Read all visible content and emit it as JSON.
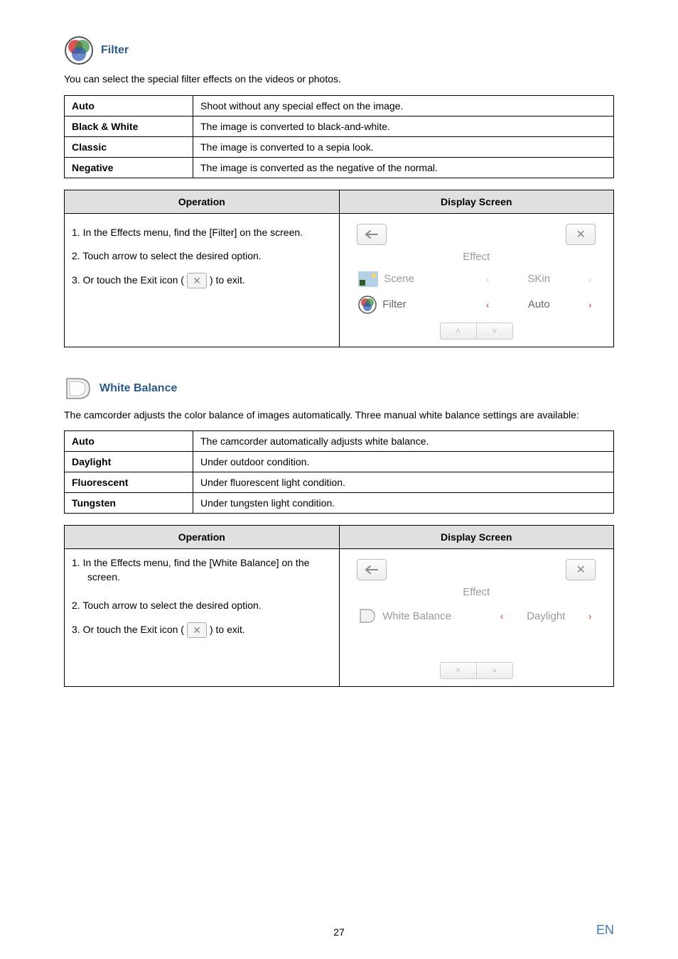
{
  "filter": {
    "title": "Filter",
    "intro": "You can select the special filter effects on the videos or photos.",
    "options": [
      {
        "name": "Auto",
        "desc": "Shoot without any special effect on the image."
      },
      {
        "name": "Black & White",
        "desc": "The image is converted to black-and-white."
      },
      {
        "name": "Classic",
        "desc": "The image is converted to a sepia look."
      },
      {
        "name": "Negative",
        "desc": "The image is converted as the negative of the normal."
      }
    ],
    "table": {
      "header_op": "Operation",
      "header_disp": "Display Screen",
      "steps": {
        "s1": "1.  In the Effects menu, find the [Filter] on the screen.",
        "s2": "2.  Touch arrow to select the desired option.",
        "s3a": "3.  Or touch the Exit icon (",
        "s3b": ") to exit."
      },
      "screen": {
        "title": "Effect",
        "row1_label": "Scene",
        "row1_value": "SKin",
        "row2_label": "Filter",
        "row2_value": "Auto"
      }
    }
  },
  "wb": {
    "title": "White Balance",
    "intro": "The camcorder adjusts the color balance of images automatically. Three manual white balance settings are available:",
    "options": [
      {
        "name": "Auto",
        "desc": "The camcorder automatically adjusts white balance."
      },
      {
        "name": "Daylight",
        "desc": "Under outdoor condition."
      },
      {
        "name": "Fluorescent",
        "desc": "Under fluorescent light condition."
      },
      {
        "name": "Tungsten",
        "desc": "Under tungsten light condition."
      }
    ],
    "table": {
      "header_op": "Operation",
      "header_disp": "Display Screen",
      "steps": {
        "s1": "1.  In the Effects menu, find the [White Balance] on the",
        "s1b": "screen.",
        "s2": "2.  Touch arrow to select the desired option.",
        "s3a": "3.  Or touch the Exit icon (",
        "s3b": ") to exit."
      },
      "screen": {
        "title": "Effect",
        "row1_label": "White Balance",
        "row1_value": "Daylight"
      }
    }
  },
  "footer": {
    "page": "27",
    "lang": "EN"
  },
  "glyphs": {
    "x": "✕",
    "back": "⬅",
    "left": "‹",
    "right": "›",
    "up": "˄",
    "down": "˅"
  }
}
